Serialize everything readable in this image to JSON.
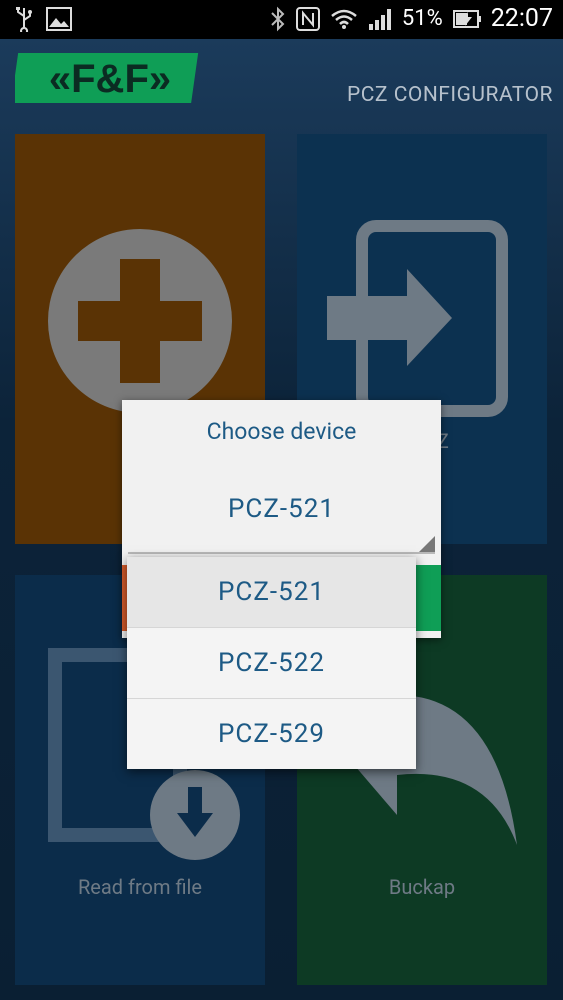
{
  "status_bar": {
    "battery_percent": "51%",
    "time": "22:07",
    "icons": [
      "usb-icon",
      "image-icon",
      "bluetooth-icon",
      "nfc-icon",
      "wifi-icon",
      "signal-icon",
      "battery-charging-icon"
    ]
  },
  "app": {
    "title": "PCZ CONFIGURATOR",
    "logo_text": "F&F"
  },
  "tiles": {
    "new_label": "",
    "read_pcz_label": "n PCZ",
    "read_file_label": "Read from file",
    "backup_label": "Buckap"
  },
  "dialog": {
    "title": "Choose device",
    "selected_value": "PCZ-521"
  },
  "dropdown": {
    "options": [
      "PCZ-521",
      "PCZ-522",
      "PCZ-529"
    ],
    "selected": "PCZ-521"
  },
  "colors": {
    "accent_text": "#1d5a85",
    "tile_orange": "#5a3305",
    "tile_blue": "#0c3150",
    "tile_green": "#0d3a24",
    "logo_green": "#0f9e56"
  }
}
